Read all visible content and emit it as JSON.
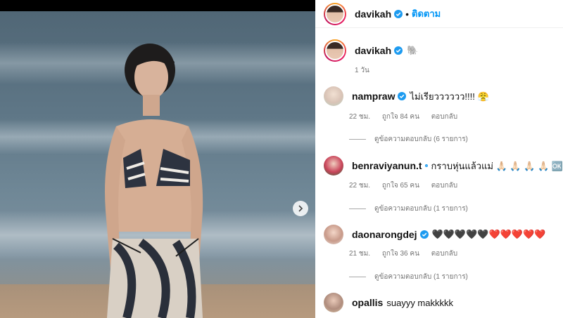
{
  "post": {
    "username": "davikah",
    "follow_label": "ติดตาม",
    "separator": "•",
    "caption_emoji": "🐘",
    "time": "1 วัน"
  },
  "comments": [
    {
      "username": "nampraw",
      "text": "ไม่เรียวววววว!!!! 😤",
      "time": "22 ชม.",
      "likes": "ถูกใจ 84 คน",
      "reply_label": "ตอบกลับ",
      "view_replies": "ดูข้อความตอบกลับ (6 รายการ)"
    },
    {
      "username": "benraviyanun.t",
      "text": "กราบหุ่นแล้วแม่ 🙏🏻 🙏🏻 🙏🏻 🙏🏻 🆗",
      "time": "22 ชม.",
      "likes": "ถูกใจ 65 คน",
      "reply_label": "ตอบกลับ",
      "view_replies": "ดูข้อความตอบกลับ (1 รายการ)"
    },
    {
      "username": "daonarongdej",
      "text": "🖤🖤🖤🖤🖤❤️❤️❤️❤️❤️",
      "time": "21 ชม.",
      "likes": "ถูกใจ 36 คน",
      "reply_label": "ตอบกลับ",
      "view_replies": "ดูข้อความตอบกลับ (1 รายการ)"
    },
    {
      "username": "opallis",
      "text": "suayyy makkkkk"
    }
  ],
  "colors": {
    "accent": "#0095f6",
    "verified": "#1d9bf0",
    "muted": "#737373"
  },
  "icons": {
    "next": "chevron-right-icon",
    "verified": "verified-badge-icon"
  }
}
